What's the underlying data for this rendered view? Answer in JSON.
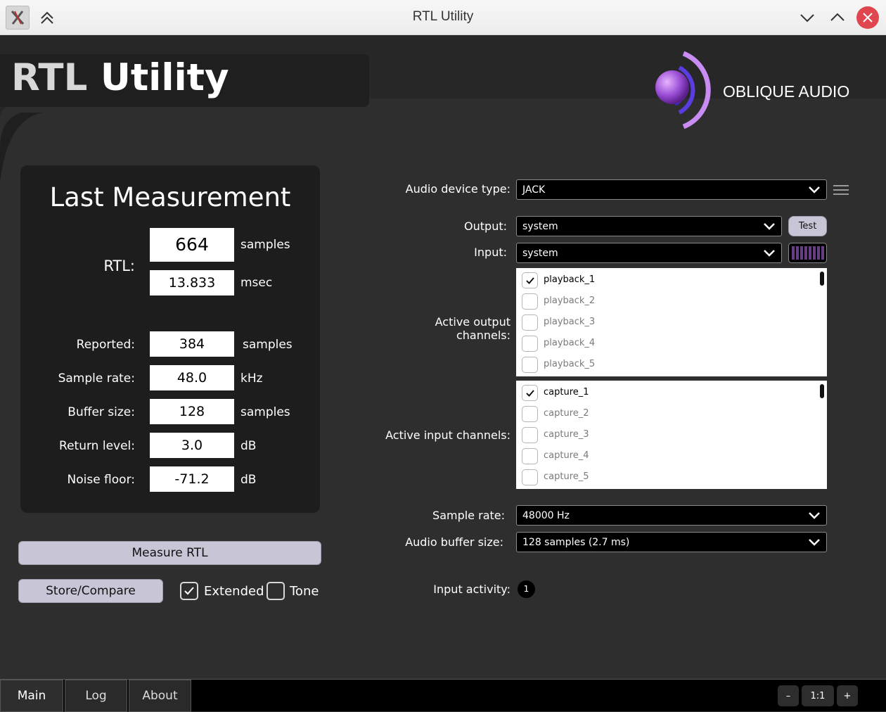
{
  "window": {
    "title": "RTL Utility"
  },
  "header": {
    "title_part1": "RTL",
    "title_part2": "Utility",
    "brand": "OBLIQUE AUDIO"
  },
  "measurement": {
    "title": "Last Measurement",
    "rtl_label": "RTL:",
    "rtl_samples": "664",
    "rtl_samples_unit": "samples",
    "rtl_msec": "13.833",
    "rtl_msec_unit": "msec",
    "rows": [
      {
        "label": "Reported:",
        "value": "384",
        "unit": "samples"
      },
      {
        "label": "Sample rate:",
        "value": "48.0",
        "unit": "kHz"
      },
      {
        "label": "Buffer size:",
        "value": "128",
        "unit": "samples"
      },
      {
        "label": "Return level:",
        "value": "3.0",
        "unit": "dB"
      },
      {
        "label": "Noise floor:",
        "value": "-71.2",
        "unit": "dB"
      }
    ]
  },
  "controls": {
    "measure_label": "Measure RTL",
    "store_label": "Store/Compare",
    "extended_label": "Extended",
    "extended_checked": true,
    "tone_label": "Tone",
    "tone_checked": false
  },
  "audio": {
    "device_type_label": "Audio device type:",
    "device_type_value": "JACK",
    "output_label": "Output:",
    "output_value": "system",
    "test_label": "Test",
    "input_label": "Input:",
    "input_value": "system",
    "active_output_label": "Active output channels:",
    "output_channels": [
      {
        "name": "playback_1",
        "checked": true
      },
      {
        "name": "playback_2",
        "checked": false
      },
      {
        "name": "playback_3",
        "checked": false
      },
      {
        "name": "playback_4",
        "checked": false
      },
      {
        "name": "playback_5",
        "checked": false
      }
    ],
    "active_input_label": "Active input channels:",
    "input_channels": [
      {
        "name": "capture_1",
        "checked": true
      },
      {
        "name": "capture_2",
        "checked": false
      },
      {
        "name": "capture_3",
        "checked": false
      },
      {
        "name": "capture_4",
        "checked": false
      },
      {
        "name": "capture_5",
        "checked": false
      }
    ],
    "sample_rate_label": "Sample rate:",
    "sample_rate_value": "48000 Hz",
    "buffer_size_label": "Audio buffer size:",
    "buffer_size_value": "128 samples (2.7 ms)",
    "input_activity_label": "Input activity:",
    "input_activity_value": "1"
  },
  "tabs": [
    {
      "label": "Main",
      "active": true
    },
    {
      "label": "Log",
      "active": false
    },
    {
      "label": "About",
      "active": false
    }
  ],
  "zoom": {
    "minus": "–",
    "level": "1:1",
    "plus": "+"
  },
  "colors": {
    "accent": "#9b4fd6",
    "close": "#e0464f",
    "button": "#c8c6d6"
  }
}
